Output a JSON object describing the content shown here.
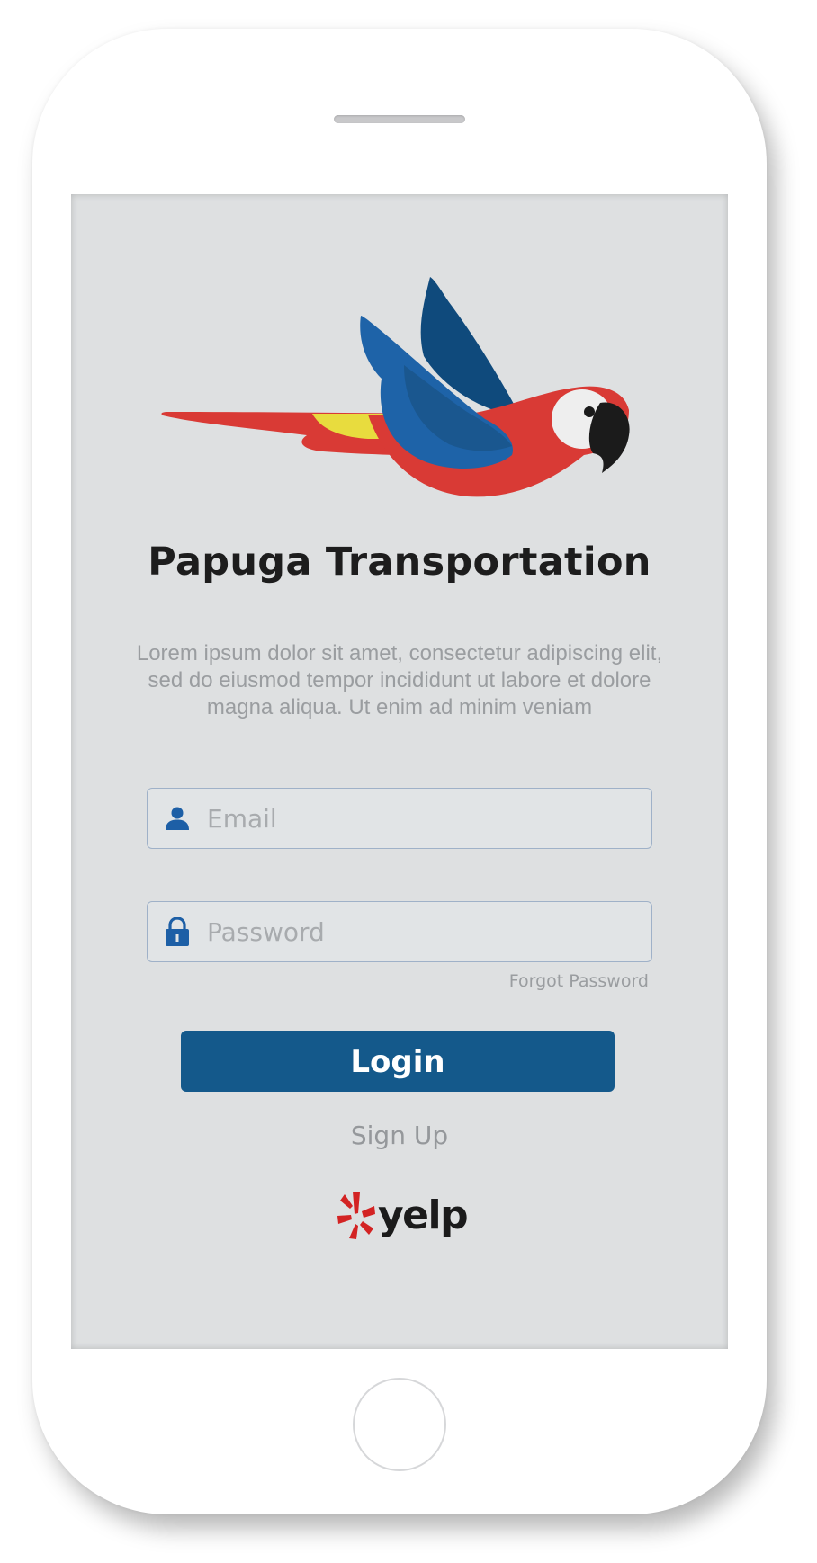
{
  "app": {
    "title": "Papuga Transportation",
    "description": "Lorem ipsum dolor sit amet, consectetur adipiscing elit, sed do eiusmod tempor incididunt ut labore et dolore magna aliqua. Ut enim ad minim veniam"
  },
  "login_form": {
    "email": {
      "placeholder": "Email",
      "value": "",
      "icon": "user-icon"
    },
    "password": {
      "placeholder": "Password",
      "value": "",
      "icon": "lock-icon"
    },
    "forgot_password_label": "Forgot Password",
    "login_label": "Login",
    "signup_label": "Sign Up"
  },
  "branding": {
    "logo_icon": "parrot-logo",
    "partner_icon": "yelp-burst-icon",
    "partner_label": "yelp"
  },
  "colors": {
    "screen_background": "#dee0e1",
    "accent_button": "#14598b",
    "icon_blue": "#1d5fa6",
    "parrot_red": "#d93a35",
    "parrot_blue": "#1e63a8",
    "parrot_dark_blue": "#0f4a7c",
    "parrot_yellow": "#e8dc3e",
    "yelp_red": "#d32323"
  }
}
